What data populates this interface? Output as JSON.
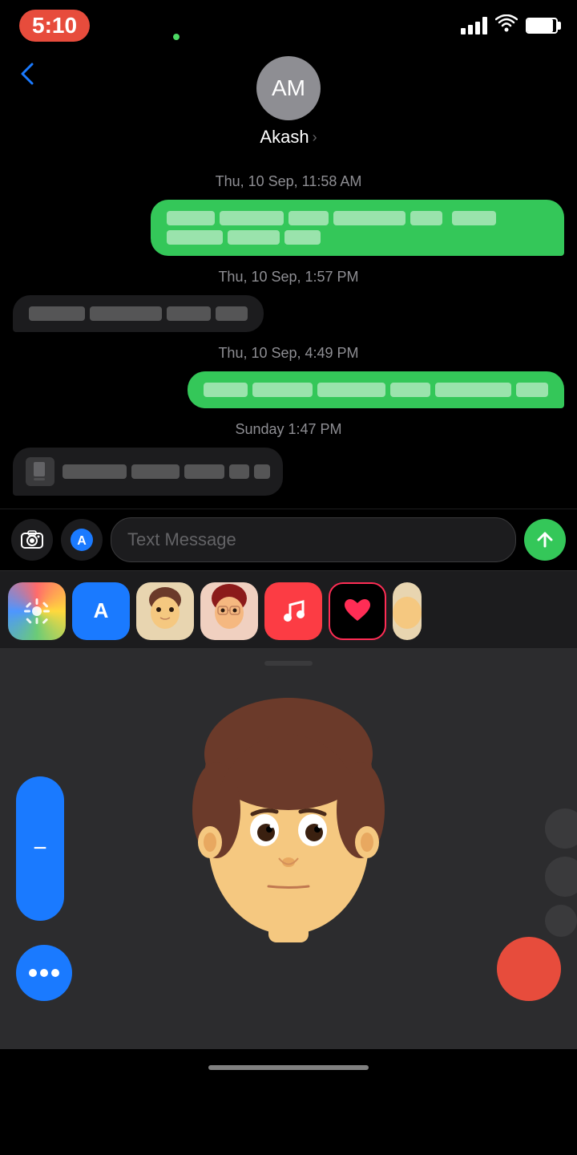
{
  "statusBar": {
    "time": "5:10",
    "signal": "signal",
    "wifi": "wifi",
    "battery": "battery"
  },
  "header": {
    "backLabel": "‹",
    "avatarInitials": "AM",
    "contactName": "Akash",
    "chevron": "›"
  },
  "messages": [
    {
      "id": "ts1",
      "type": "timestamp",
      "text": "Thu, 10 Sep, 11:58 AM"
    },
    {
      "id": "msg1",
      "type": "sent",
      "redacted": true
    },
    {
      "id": "ts2",
      "type": "timestamp",
      "text": "Thu, 10 Sep, 1:57 PM"
    },
    {
      "id": "msg2",
      "type": "received",
      "redacted": true
    },
    {
      "id": "ts3",
      "type": "timestamp",
      "text": "Thu, 10 Sep, 4:49 PM"
    },
    {
      "id": "msg3",
      "type": "sent",
      "redacted": true
    },
    {
      "id": "ts4",
      "type": "timestamp",
      "text": "Sunday 1:47 PM"
    },
    {
      "id": "msg4",
      "type": "received-icon",
      "redacted": true
    }
  ],
  "inputBar": {
    "cameraIcon": "📷",
    "appStoreIcon": "🅐",
    "placeholder": "Text Message",
    "sendIcon": "↑"
  },
  "appTray": {
    "apps": [
      {
        "name": "Photos",
        "type": "photos"
      },
      {
        "name": "App Store",
        "type": "appstore"
      },
      {
        "name": "Memoji 1",
        "type": "memoji1"
      },
      {
        "name": "Memoji 2",
        "type": "memoji2"
      },
      {
        "name": "Music",
        "type": "music"
      },
      {
        "name": "Fitness",
        "type": "fitness"
      },
      {
        "name": "Partial",
        "type": "partial"
      }
    ]
  },
  "memoji": {
    "description": "Memoji face animation area"
  },
  "homeBar": {
    "label": "home indicator"
  }
}
